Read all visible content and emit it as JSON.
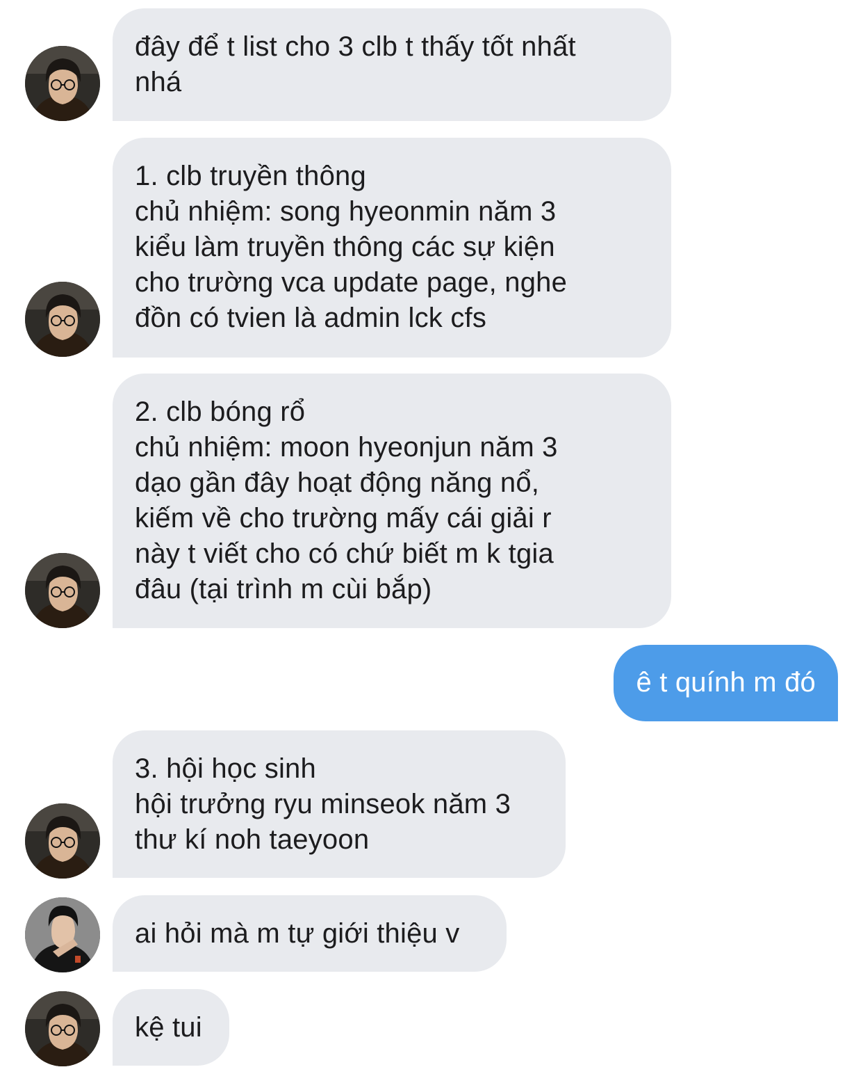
{
  "conversation": {
    "messages": [
      {
        "id": "m1",
        "sender": "them",
        "avatar": "avatar-glasses",
        "text": "đây để t list cho 3 clb t thấy tốt nhất\nnhá"
      },
      {
        "id": "m2",
        "sender": "them",
        "avatar": "avatar-glasses",
        "text": "1. clb truyền thông\nchủ nhiệm: song hyeonmin năm 3\nkiểu làm truyền thông các sự kiện\ncho trường vca update page, nghe\nđồn có tvien là admin lck cfs"
      },
      {
        "id": "m3",
        "sender": "them",
        "avatar": "avatar-glasses",
        "text": "2. clb bóng rổ\nchủ nhiệm: moon hyeonjun năm 3\ndạo gần đây hoạt động năng nổ,\nkiếm về cho trường mấy cái giải r\nnày t viết cho có chứ biết m k tgia\nđâu (tại trình m cùi bắp)"
      },
      {
        "id": "m4",
        "sender": "me",
        "text": "ê t quính m đó"
      },
      {
        "id": "m5",
        "sender": "them",
        "avatar": "avatar-glasses",
        "text": "3. hội học sinh\nhội trưởng ryu minseok năm 3\nthư kí noh taeyoon"
      },
      {
        "id": "m6",
        "sender": "them",
        "avatar": "avatar-pose",
        "text": "ai hỏi mà m tự giới thiệu v"
      },
      {
        "id": "m7",
        "sender": "them",
        "avatar": "avatar-glasses",
        "text": "kệ tui"
      }
    ]
  },
  "colors": {
    "incoming_bubble": "#e8eaee",
    "outgoing_bubble": "#4d9ce9",
    "incoming_text": "#1c1c1e",
    "outgoing_text": "#ffffff"
  }
}
